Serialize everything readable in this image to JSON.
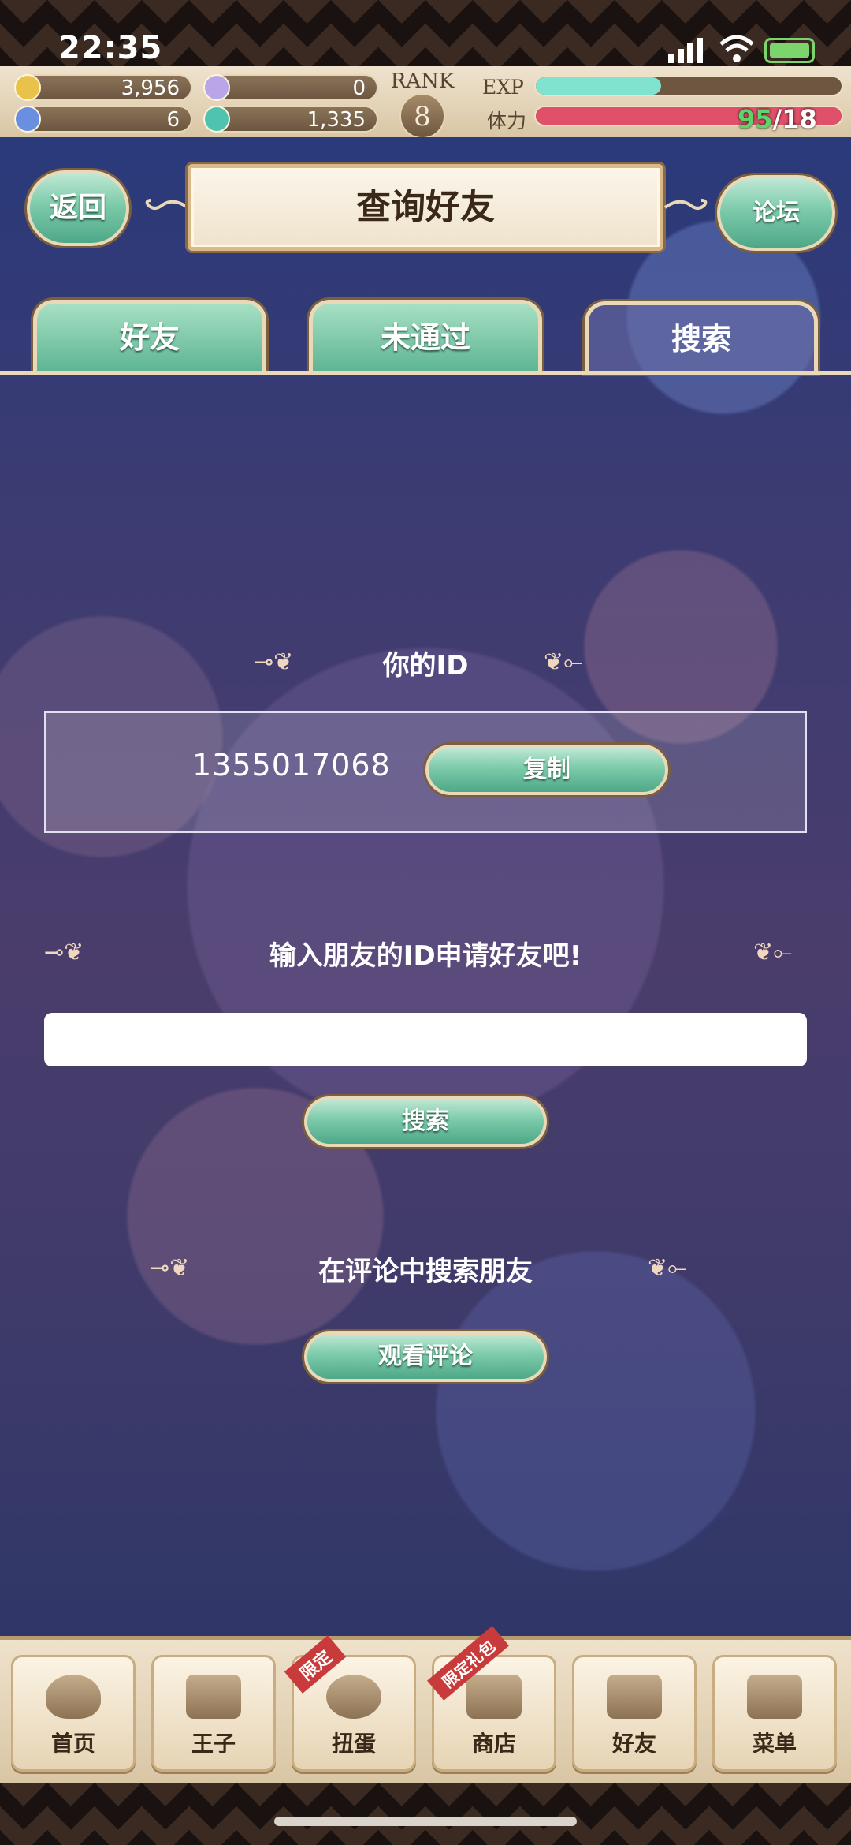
{
  "status": {
    "time": "22:35",
    "signal_icon": "signal-icon",
    "wifi_icon": "wifi-icon",
    "battery_icon": "battery-charging-icon"
  },
  "resources": {
    "gold": "3,956",
    "feather": "0",
    "crystal": "6",
    "gem": "1,335",
    "rank_label": "RANK",
    "rank_value": "8",
    "exp_label": "EXP",
    "exp_progress": 0.41,
    "stamina_label": "体力",
    "stamina_current": "95",
    "stamina_max": "/18",
    "stamina_progress": 1.0
  },
  "header": {
    "back": "返回",
    "title": "查询好友",
    "forum": "论坛"
  },
  "tabs": [
    {
      "label": "好友",
      "active": false
    },
    {
      "label": "未通过",
      "active": false
    },
    {
      "label": "搜索",
      "active": true
    }
  ],
  "my_id": {
    "title": "你的ID",
    "value": "1355017068",
    "copy": "复制"
  },
  "search": {
    "title": "输入朋友的ID申请好友吧!",
    "placeholder": "",
    "button": "搜索"
  },
  "comments": {
    "title": "在评论中搜索朋友",
    "button": "观看评论"
  },
  "nav": [
    {
      "label": "首页",
      "icon": "heart-icon"
    },
    {
      "label": "王子",
      "icon": "crown-icon"
    },
    {
      "label": "扭蛋",
      "icon": "ring-icon",
      "badge": "限定"
    },
    {
      "label": "商店",
      "icon": "shop-icon",
      "badge": "限定礼包"
    },
    {
      "label": "好友",
      "icon": "tiara-icon"
    },
    {
      "label": "菜单",
      "icon": "grid-icon"
    }
  ],
  "colors": {
    "accent_green": "#7ccbaa",
    "exp_bar": "#7fe3cf",
    "stamina_bar": "#e0506a",
    "frame": "#e9d9b8"
  }
}
